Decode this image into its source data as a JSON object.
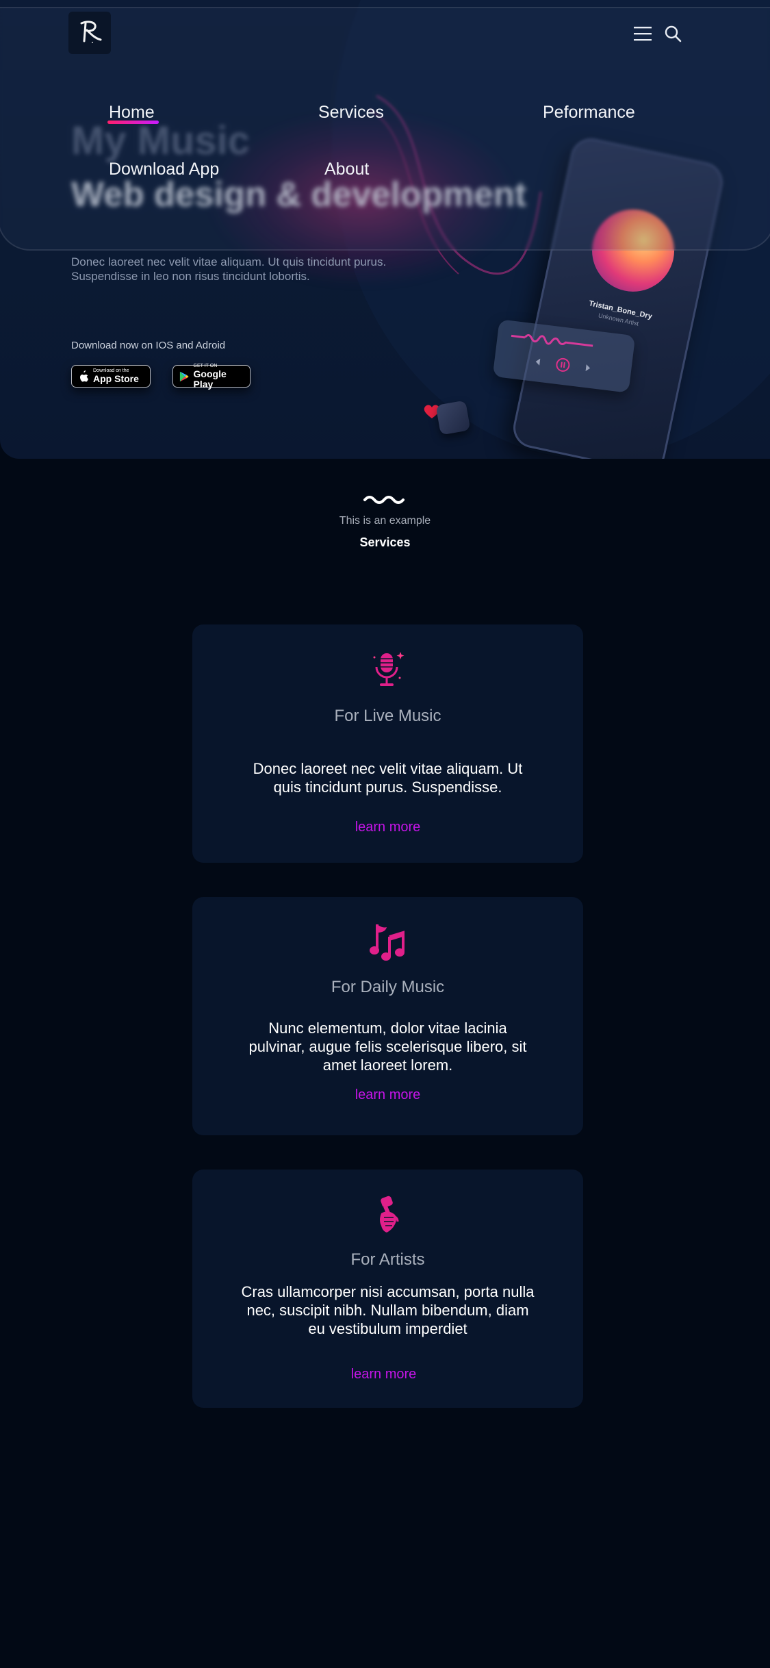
{
  "brand": {
    "logo_icon": "signature-r-logo-icon"
  },
  "header": {
    "menu_icon": "hamburger-menu-icon",
    "search_icon": "search-icon"
  },
  "nav": {
    "items": [
      {
        "label": "Home",
        "active": true
      },
      {
        "label": "Services"
      },
      {
        "label": "Peformance"
      },
      {
        "label": "Download App"
      },
      {
        "label": "About"
      }
    ]
  },
  "hero": {
    "title": "My Music",
    "subtitle": "Web design & development",
    "description": "Donec laoreet nec velit vitae aliquam. Ut quis tincidunt purus. Suspendisse in leo non risus tincidunt lobortis.",
    "download_label": "Download now on IOS and Adroid",
    "app_store": {
      "small": "Download on the",
      "big": "App Store"
    },
    "google_play": {
      "small": "GET IT ON",
      "big": "Google Play"
    },
    "phone": {
      "track_title": "Tristan_Bone_Dry",
      "track_artist": "Unknown Artist"
    }
  },
  "services_header": {
    "eyebrow": "This is an example",
    "title": "Services"
  },
  "cards": [
    {
      "icon": "microphone-icon",
      "title": "For Live Music",
      "body": "Donec laoreet nec velit vitae aliquam. Ut quis tincidunt purus. Suspendisse.",
      "link": "learn more"
    },
    {
      "icon": "music-notes-icon",
      "title": "For Daily Music",
      "body": "Nunc elementum, dolor vitae lacinia pulvinar, augue felis scelerisque libero, sit amet laoreet lorem.",
      "link": "learn more"
    },
    {
      "icon": "hand-microphone-icon",
      "title": "For Artists",
      "body": "Cras ullamcorper nisi accumsan, porta nulla nec, suscipit nibh. Nullam bibendum, diam eu vestibulum imperdiet",
      "link": "learn more"
    }
  ],
  "colors": {
    "accent_pink": "#ff1f6b",
    "accent_magenta": "#c415e6",
    "background": "#020915",
    "card_background": "#08152b"
  }
}
